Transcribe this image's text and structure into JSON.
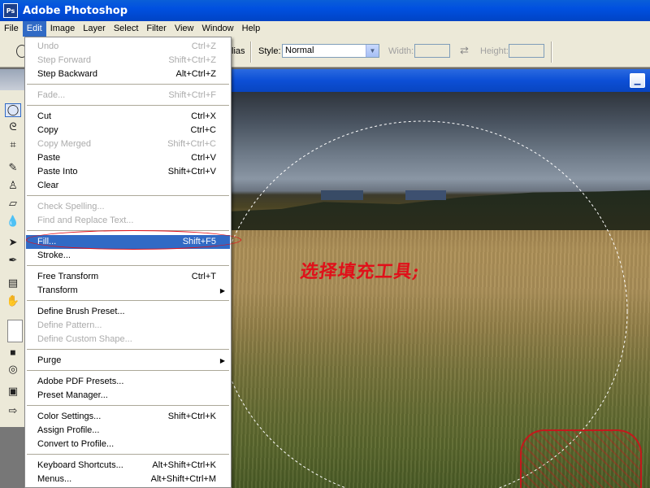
{
  "window": {
    "title": "Adobe Photoshop",
    "logo_text": "Ps"
  },
  "menubar": [
    "File",
    "Edit",
    "Image",
    "Layer",
    "Select",
    "Filter",
    "View",
    "Window",
    "Help"
  ],
  "options": {
    "antialias_label": "lias",
    "style_label": "Style:",
    "style_value": "Normal",
    "width_label": "Width:",
    "height_label": "Height:"
  },
  "edit_menu": {
    "groups": [
      [
        {
          "label": "Undo",
          "shortcut": "Ctrl+Z",
          "enabled": false
        },
        {
          "label": "Step Forward",
          "shortcut": "Shift+Ctrl+Z",
          "enabled": false
        },
        {
          "label": "Step Backward",
          "shortcut": "Alt+Ctrl+Z",
          "enabled": true
        }
      ],
      [
        {
          "label": "Fade...",
          "shortcut": "Shift+Ctrl+F",
          "enabled": false
        }
      ],
      [
        {
          "label": "Cut",
          "shortcut": "Ctrl+X",
          "enabled": true
        },
        {
          "label": "Copy",
          "shortcut": "Ctrl+C",
          "enabled": true
        },
        {
          "label": "Copy Merged",
          "shortcut": "Shift+Ctrl+C",
          "enabled": false
        },
        {
          "label": "Paste",
          "shortcut": "Ctrl+V",
          "enabled": true
        },
        {
          "label": "Paste Into",
          "shortcut": "Shift+Ctrl+V",
          "enabled": true
        },
        {
          "label": "Clear",
          "shortcut": "",
          "enabled": true
        }
      ],
      [
        {
          "label": "Check Spelling...",
          "shortcut": "",
          "enabled": false
        },
        {
          "label": "Find and Replace Text...",
          "shortcut": "",
          "enabled": false
        }
      ],
      [
        {
          "label": "Fill...",
          "shortcut": "Shift+F5",
          "enabled": true,
          "highlighted": true
        },
        {
          "label": "Stroke...",
          "shortcut": "",
          "enabled": true
        }
      ],
      [
        {
          "label": "Free Transform",
          "shortcut": "Ctrl+T",
          "enabled": true
        },
        {
          "label": "Transform",
          "shortcut": "",
          "enabled": true,
          "submenu": true
        }
      ],
      [
        {
          "label": "Define Brush Preset...",
          "shortcut": "",
          "enabled": true
        },
        {
          "label": "Define Pattern...",
          "shortcut": "",
          "enabled": false
        },
        {
          "label": "Define Custom Shape...",
          "shortcut": "",
          "enabled": false
        }
      ],
      [
        {
          "label": "Purge",
          "shortcut": "",
          "enabled": true,
          "submenu": true
        }
      ],
      [
        {
          "label": "Adobe PDF Presets...",
          "shortcut": "",
          "enabled": true
        },
        {
          "label": "Preset Manager...",
          "shortcut": "",
          "enabled": true
        }
      ],
      [
        {
          "label": "Color Settings...",
          "shortcut": "Shift+Ctrl+K",
          "enabled": true
        },
        {
          "label": "Assign Profile...",
          "shortcut": "",
          "enabled": true
        },
        {
          "label": "Convert to Profile...",
          "shortcut": "",
          "enabled": true
        }
      ],
      [
        {
          "label": "Keyboard Shortcuts...",
          "shortcut": "Alt+Shift+Ctrl+K",
          "enabled": true
        },
        {
          "label": "Menus...",
          "shortcut": "Alt+Shift+Ctrl+M",
          "enabled": true
        }
      ]
    ]
  },
  "annotation": {
    "text": "选择填充工具;"
  },
  "colors": {
    "menu_highlight": "#316ac5",
    "annotation_red": "#e0101a",
    "xp_face": "#ece9d8"
  }
}
